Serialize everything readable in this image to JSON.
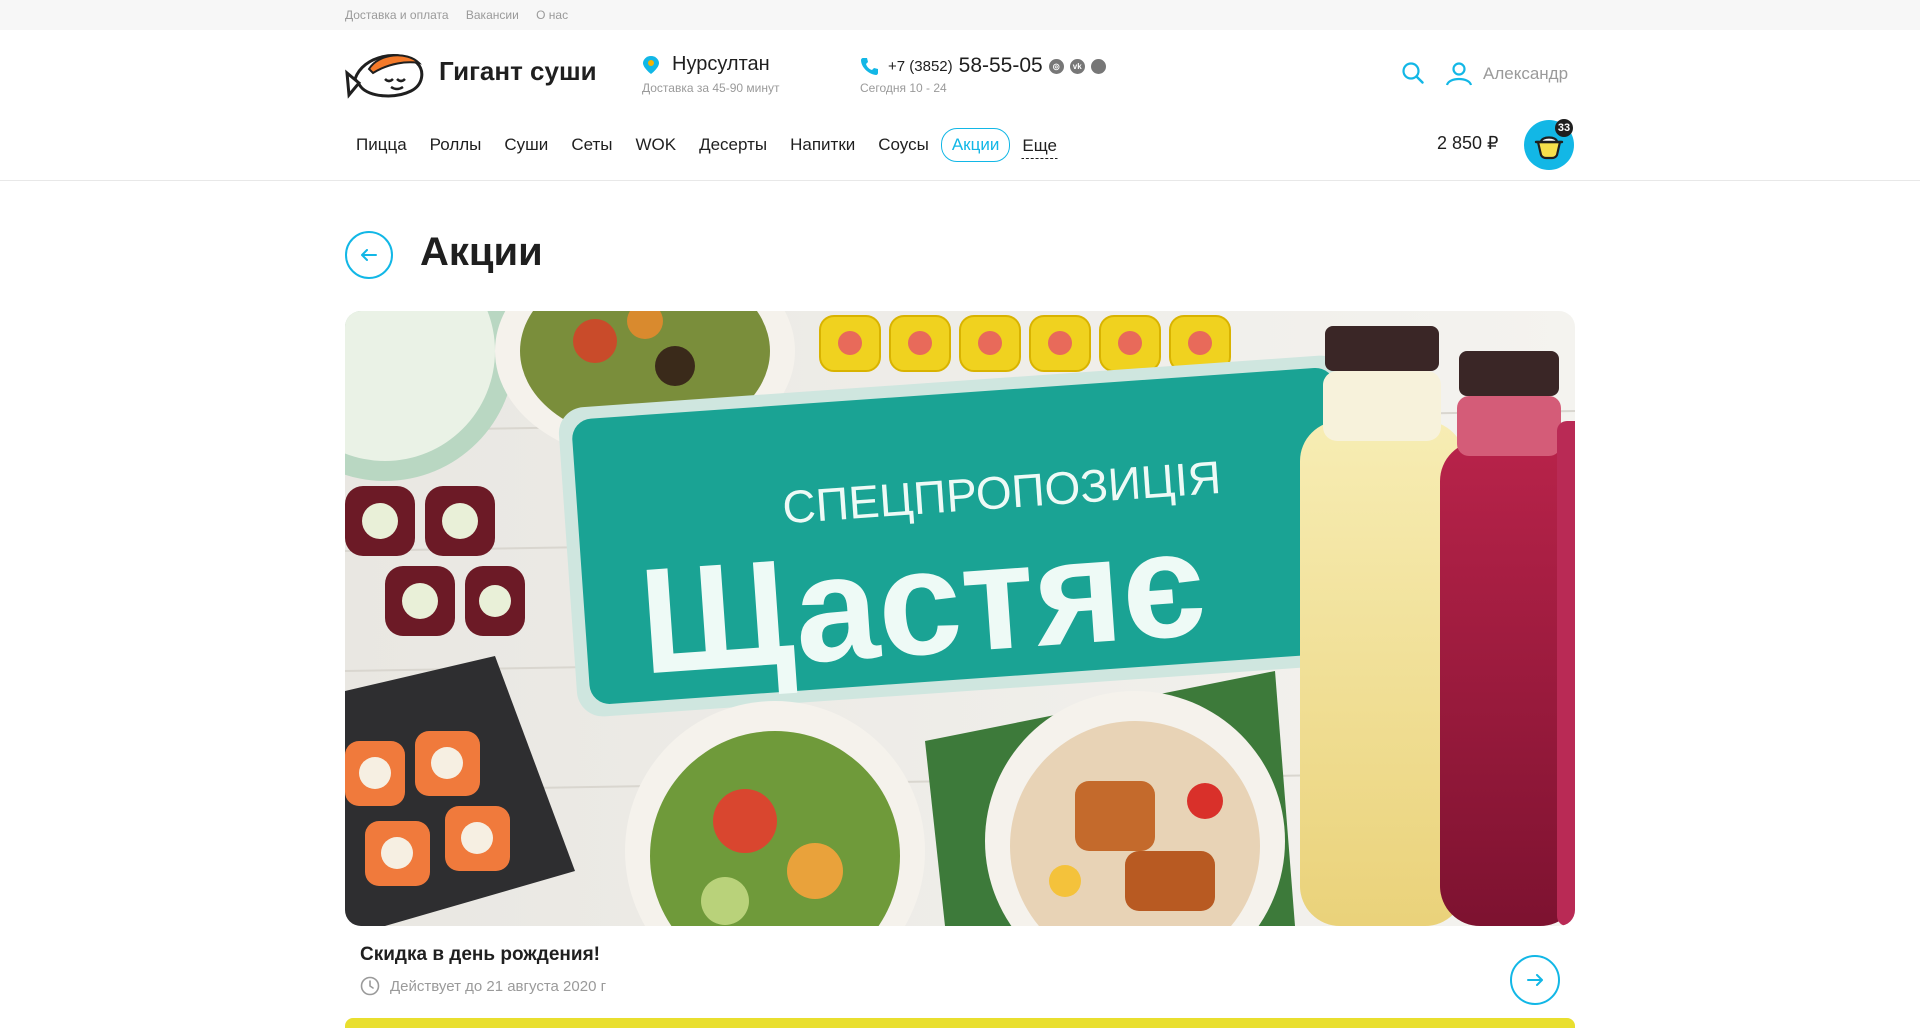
{
  "topbar": {
    "links": [
      "Доставка и оплата",
      "Вакансии",
      "О нас"
    ]
  },
  "brand": {
    "name": "Гигант суши"
  },
  "location": {
    "city": "Нурсултан",
    "delivery_time": "Доставка за 45-90 минут"
  },
  "contacts": {
    "phone_code": "+7 (3852)",
    "phone_number": "58-55-05",
    "hours": "Сегодня 10 - 24",
    "social": [
      "instagram-icon",
      "vk-icon",
      "other-icon"
    ]
  },
  "user": {
    "name": "Александр"
  },
  "nav": {
    "items": [
      "Пицца",
      "Роллы",
      "Суши",
      "Сеты",
      "WOK",
      "Десерты",
      "Напитки",
      "Соусы",
      "Акции"
    ],
    "more": "Еще",
    "active": "Акции"
  },
  "cart": {
    "sum": "2 850 ₽",
    "count": "33"
  },
  "page": {
    "title": "Акции"
  },
  "promo": {
    "banner_top": "СПЕЦПРОПОЗИЦІЯ",
    "banner_main": "Щастяє",
    "title": "Скидка в день рождения!",
    "valid_until": "Действует до 21 августа 2020 г"
  },
  "colors": {
    "accent": "#12b7e6",
    "banner_green": "#1aa394",
    "text": "#1f1f1f",
    "muted": "#9a9a9a"
  }
}
